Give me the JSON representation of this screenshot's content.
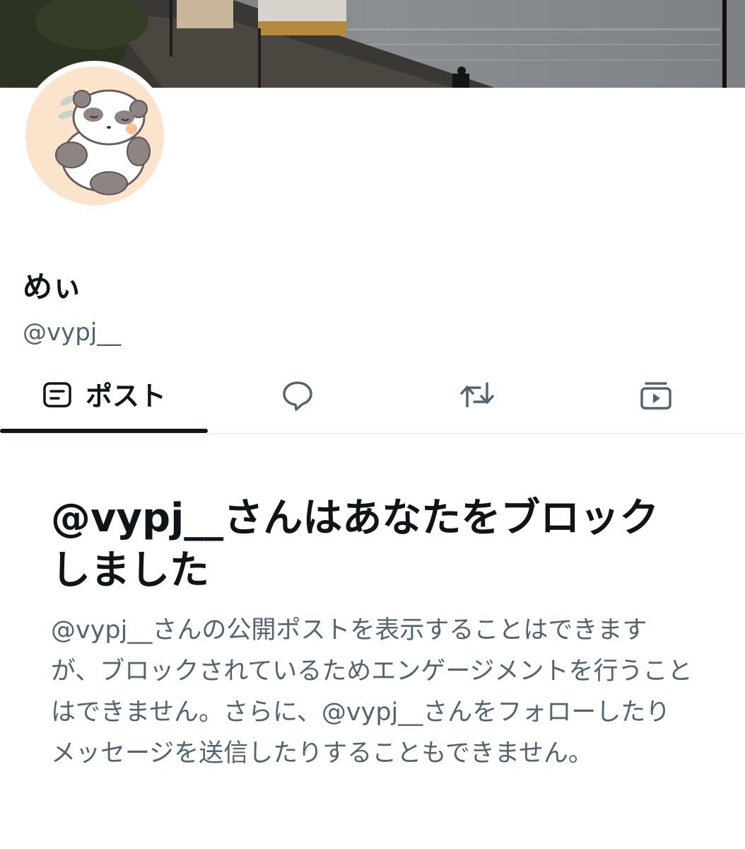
{
  "profile": {
    "display_name": "めぃ",
    "handle": "@vypj__"
  },
  "tabs": [
    {
      "label": "ポスト",
      "icon": "posts-icon",
      "selected": true
    },
    {
      "label": "",
      "icon": "replies-icon",
      "selected": false
    },
    {
      "label": "",
      "icon": "repost-icon",
      "selected": false
    },
    {
      "label": "",
      "icon": "media-icon",
      "selected": false
    }
  ],
  "blocked": {
    "title": "@vypj__さんはあなたをブロックしました",
    "body": "@vypj__さんの公開ポストを表示することはできますが、ブロックされているためエンゲージメントを行うことはできません。さらに、@vypj__さんをフォローしたりメッセージを送信したりすることもできません。"
  },
  "colors": {
    "primary_text": "#0f1419",
    "secondary_text": "#536471",
    "divider": "#eff3f4",
    "avatar_background": "#fbe3cc"
  }
}
